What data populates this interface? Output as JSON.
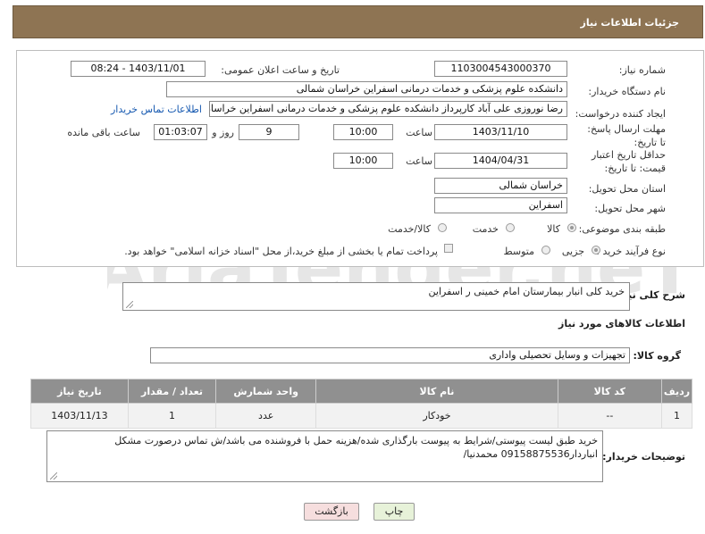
{
  "header": {
    "title": "جزئیات اطلاعات نیاز"
  },
  "form": {
    "need_number": {
      "label": "شماره نیاز:",
      "value": "1103004543000370"
    },
    "announce": {
      "label": "تاریخ و ساعت اعلان عمومی:",
      "value": "1403/11/01 - 08:24"
    },
    "buyer_org": {
      "label": "نام دستگاه خریدار:",
      "value": "دانشکده علوم پزشکی و خدمات درمانی اسفراین خراسان شمالی"
    },
    "creator": {
      "label": "ایجاد کننده درخواست:",
      "value": "رضا نوروزی علی آباد کارپرداز  دانشکده علوم پزشکی و خدمات درمانی اسفراین خراسان شمالی",
      "contact_link": "اطلاعات تماس خریدار"
    },
    "deadline": {
      "label": "مهلت ارسال پاسخ: تا تاریخ:",
      "date": "1403/11/10",
      "time_label": "ساعت",
      "time": "10:00",
      "days": "9",
      "days_label": "روز و",
      "remaining": "01:03:07",
      "remaining_label": "ساعت باقی مانده"
    },
    "validity": {
      "label": "حداقل تاریخ اعتبار قیمت: تا تاریخ:",
      "date": "1404/04/31",
      "time_label": "ساعت",
      "time": "10:00"
    },
    "province": {
      "label": "استان محل تحویل:",
      "value": "خراسان شمالی"
    },
    "city": {
      "label": "شهر محل تحویل:",
      "value": "اسفراین"
    },
    "category": {
      "label": "طبقه بندی موضوعی:",
      "options": [
        "کالا",
        "خدمت",
        "کالا/خدمت"
      ]
    },
    "process": {
      "label": "نوع فرآیند خرید :",
      "options": [
        "جزیی",
        "متوسط"
      ],
      "note": "پرداخت تمام یا بخشی از مبلغ خرید،از محل \"اسناد خزانه اسلامی\" خواهد بود."
    }
  },
  "summary": {
    "label": "شرح کلی نیاز:",
    "value": "خرید کلی انبار بیمارستان امام خمینی ر اسفراین"
  },
  "goods_info_title": "اطلاعات کالاهای مورد نیاز",
  "goods_group": {
    "label": "گروه کالا:",
    "value": "تجهیزات و وسایل تحصیلی واداری"
  },
  "table": {
    "headers": [
      "ردیف",
      "کد کالا",
      "نام کالا",
      "واحد شمارش",
      "تعداد / مقدار",
      "تاریخ نیاز"
    ],
    "rows": [
      [
        "1",
        "--",
        "خودکار",
        "عدد",
        "1",
        "1403/11/13"
      ]
    ]
  },
  "buyer_notes": {
    "label": "توضیحات خریدار:",
    "value": "خرید طبق لیست پیوستی/شرایط به پیوست بارگذاری شده/هزینه حمل با فروشنده می باشد/ش تماس درصورت مشکل انباردار09158875536 محمدنیا/"
  },
  "buttons": {
    "print": "چاپ",
    "back": "بازگشت"
  },
  "watermark": {
    "text": "AriaTender.neT",
    "color": "#e6e6e6"
  },
  "colors": {
    "header_bg": "#8e7453",
    "table_header_bg": "#909090",
    "back_button_bg": "#f6dede",
    "print_button_bg": "#e7f2d9"
  }
}
